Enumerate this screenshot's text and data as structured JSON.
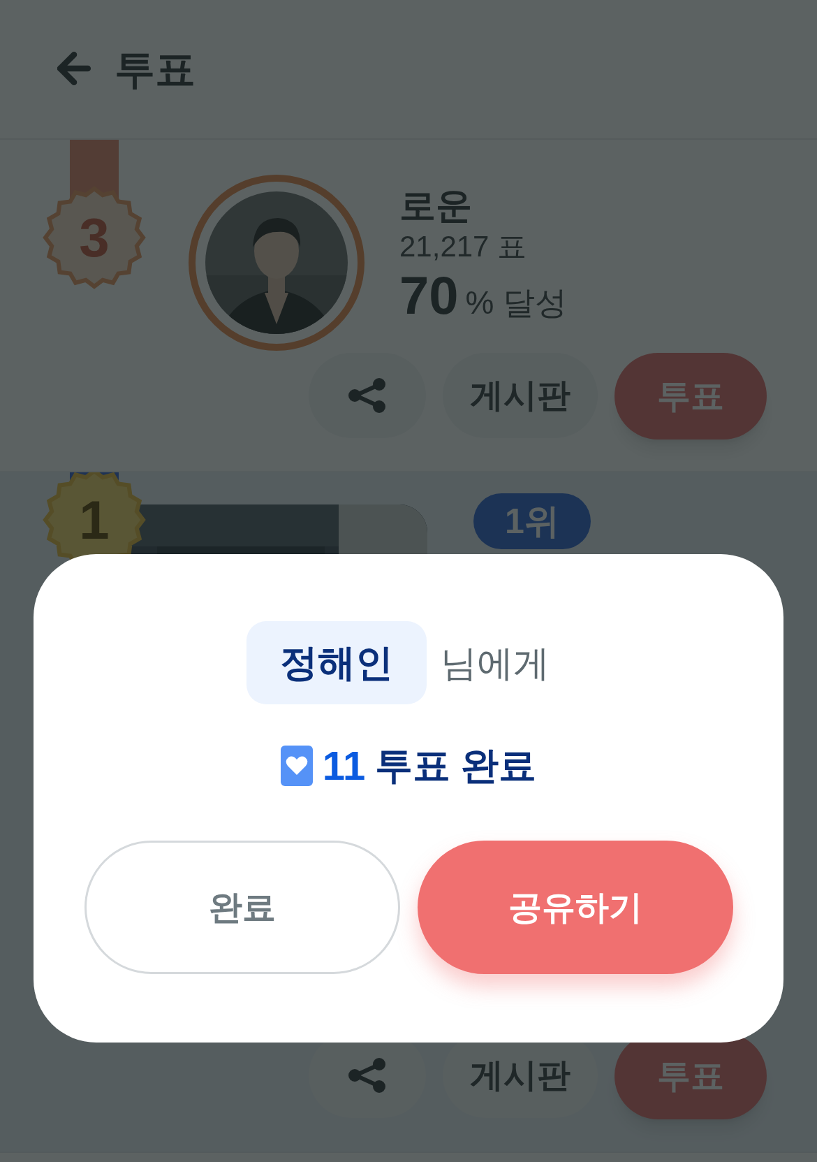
{
  "header": {
    "title": "투표"
  },
  "candidates": [
    {
      "rank": "3",
      "kind": "bronze",
      "name": "로운",
      "votes": "21,217 표",
      "percent": "70",
      "percent_label": "% 달성",
      "board_label": "게시판",
      "vote_label": "투표"
    },
    {
      "rank": "1",
      "kind": "gold",
      "badge": "1위",
      "board_label": "게시판",
      "vote_label": "투표"
    }
  ],
  "modal": {
    "recipient": "정해인",
    "recipient_suffix": "님에게",
    "count": "11",
    "result": "투표 완료",
    "buttons": [
      {
        "label": "완료",
        "kind": "secondary"
      },
      {
        "label": "공유하기",
        "kind": "primary"
      }
    ]
  }
}
